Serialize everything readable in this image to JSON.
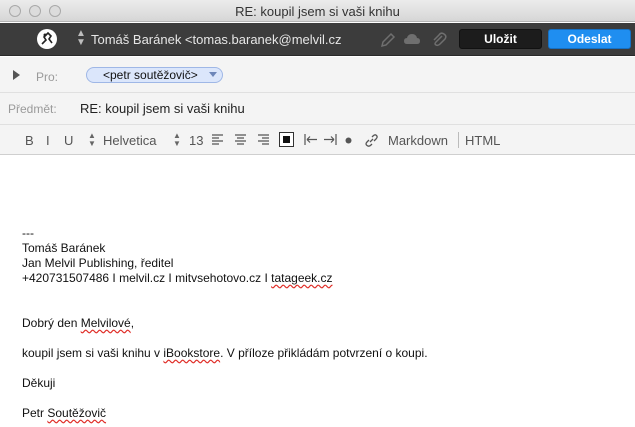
{
  "window": {
    "title": "RE: koupil jsem si vaši knihu"
  },
  "toolbar": {
    "from": "Tomáš Baránek <tomas.baranek@melvil.cz",
    "save_label": "Uložit",
    "send_label": "Odeslat",
    "icons": [
      "logo-icon",
      "pencil-icon",
      "cloud-icon",
      "paperclip-icon"
    ]
  },
  "header": {
    "to_label": "Pro:",
    "to_token": "<petr soutěžovič>",
    "subject_label": "Předmět:",
    "subject_value": "RE: koupil jsem si vaši knihu"
  },
  "format": {
    "bold": "B",
    "italic": "I",
    "underline": "U",
    "font": "Helvetica",
    "size": "13",
    "markdown": "Markdown",
    "html": "HTML"
  },
  "body": {
    "signature": {
      "sep": "---",
      "name": "Tomáš Baránek",
      "role": "Jan Melvil Publishing, ředitel",
      "contacts_prefix": "+420731507486 I melvil.cz I mitvsehotovo.cz I ",
      "contacts_link": "tatageek.cz"
    },
    "greeting_prefix": "Dobrý den ",
    "greeting_name": "Melvilové",
    "greeting_suffix": ",",
    "msg_prefix": "koupil jsem si vaši knihu v ",
    "msg_store": "iBookstore",
    "msg_suffix": ". V příloze přikládám potvrzení o koupi.",
    "thanks": "Děkuji",
    "sender_first": "Petr ",
    "sender_last": "Soutěžovič"
  },
  "colors": {
    "toolbar": "#3c3c3c",
    "send_button": "#1f8ef0",
    "token": "#dbe6fb"
  }
}
